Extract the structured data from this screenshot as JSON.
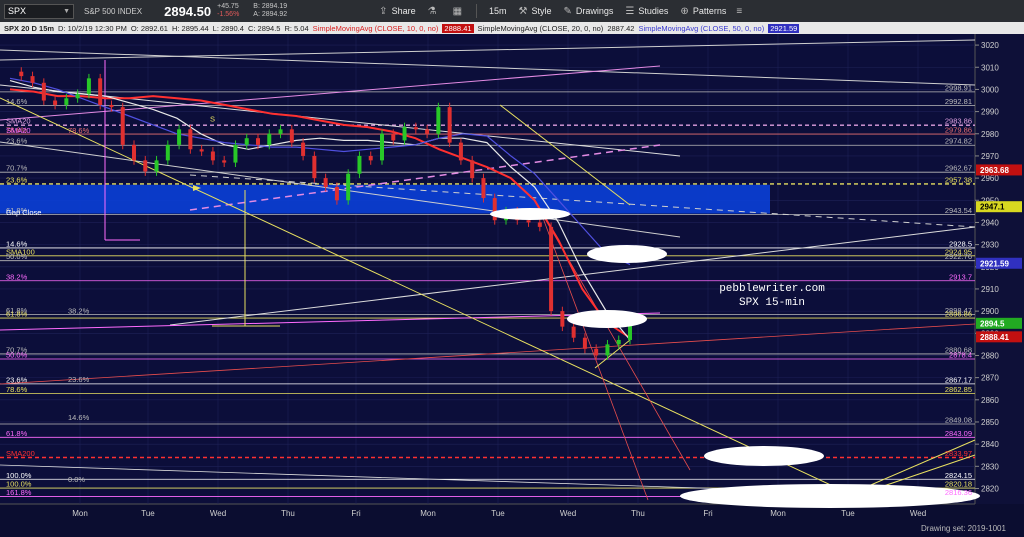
{
  "toolbar": {
    "symbol": "SPX",
    "name": "S&P 500 INDEX",
    "last": "2894.50",
    "change": "+45.75",
    "change_pct": "-1.56%",
    "bid": "B: 2894.19",
    "ask": "A: 2894.92",
    "share_label": "Share",
    "interval": "15m",
    "style_label": "Style",
    "drawings_label": "Drawings",
    "studies_label": "Studies",
    "patterns_label": "Patterns"
  },
  "infobar": {
    "desc": "SPX 20 D 15m",
    "date": "D: 10/2/19 12:30 PM",
    "open": "O: 2892.61",
    "high": "H: 2895.44",
    "low": "L: 2890.4",
    "close": "C: 2894.5",
    "range": "R: 5.04",
    "sma10": "SimpleMovingAvg (CLOSE, 10, 0, no)",
    "sma10_val": "2888.41",
    "sma20": "SimpleMovingAvg (CLOSE, 20, 0, no)",
    "sma20_val": "2887.42",
    "sma50": "SimpleMovingAvg (CLOSE, 50, 0, no)",
    "sma50_val": "2921.59"
  },
  "annotation": {
    "line1": "pebblewriter.com",
    "line2": "SPX 15-min"
  },
  "footer": {
    "drawing_set": "Drawing set: 2019-1001"
  },
  "colors": {
    "background": "#0c0e3a",
    "price_tag_red": "#c21010",
    "price_tag_blue": "#3030c0",
    "fib_yellow": "#e8e060",
    "fib_magenta": "#ff6cff"
  },
  "chart_data": {
    "type": "line",
    "title": "SPX 15-min",
    "y_range": [
      2813,
      3025
    ],
    "y_ticks": [
      3020,
      3010,
      3000,
      2990,
      2980,
      2970,
      2960,
      2950,
      2940,
      2930,
      2920,
      2910,
      2900,
      2890,
      2880,
      2870,
      2860,
      2850,
      2840,
      2830,
      2820
    ],
    "x_labels": [
      "Mon",
      "Tue",
      "Wed",
      "Thu",
      "Fri",
      "Mon",
      "Tue",
      "Wed",
      "Thu",
      "Fri",
      "Mon",
      "Tue",
      "Wed"
    ],
    "price_tags": [
      {
        "label": "2963.68",
        "value": 2963.68,
        "color": "#c21010"
      },
      {
        "label": "2947.1",
        "value": 2947.1,
        "color": "#d8d820"
      },
      {
        "label": "2921.59",
        "value": 2921.59,
        "color": "#3030c0"
      },
      {
        "label": "2894.5",
        "value": 2894.5,
        "color": "#22aa22"
      },
      {
        "label": "2888.41",
        "value": 2888.41,
        "color": "#c21010"
      }
    ],
    "horizontal_levels": [
      {
        "value": 2998.91,
        "right": "2998.91",
        "left": "",
        "color": "#bbbbbb"
      },
      {
        "value": 2992.81,
        "right": "2992.81",
        "left": "14.6%",
        "color": "#bbbbbb"
      },
      {
        "value": 2983.86,
        "right": "2983.86",
        "left": "SMA20",
        "color": "#e0a0e0",
        "dashed": true
      },
      {
        "value": 2979.86,
        "right": "2979.86",
        "left": "78.6%",
        "color": "#e86e6e"
      },
      {
        "value": 2974.82,
        "right": "2974.82",
        "left": "23.6%",
        "color": "#bbbbbb"
      },
      {
        "value": 2962.67,
        "right": "2962.67",
        "left": "70.7%",
        "color": "#bbbbbb"
      },
      {
        "value": 2957.38,
        "right": "2957.38",
        "left": "23.6%",
        "color": "#e8e060",
        "dashed": true
      },
      {
        "value": 2943.54,
        "right": "2943.54",
        "left": "61.8%",
        "color": "#bbbbbb"
      },
      {
        "value": 2928.5,
        "right": "2928.5",
        "left": "14.6%",
        "color": "#ffffff"
      },
      {
        "value": 2924.95,
        "right": "2924.95",
        "left": "SMA100",
        "color": "#e8e060"
      },
      {
        "value": 2922.76,
        "right": "2922.76",
        "left": "50.0%",
        "color": "#bbbbbb"
      },
      {
        "value": 2913.7,
        "right": "2913.7",
        "left": "38.2%",
        "color": "#ff6cff"
      },
      {
        "value": 2898.47,
        "right": "2898.47",
        "left": "61.8%",
        "color": "#bbbbbb"
      },
      {
        "value": 2896.86,
        "right": "2896.86",
        "left": "61.8%",
        "color": "#e8e060"
      },
      {
        "value": 2880.68,
        "right": "2880.68",
        "left": "70.7%",
        "color": "#bbbbbb"
      },
      {
        "value": 2878.4,
        "right": "2878.4",
        "left": "50.0%",
        "color": "#ff6cff"
      },
      {
        "value": 2867.17,
        "right": "2867.17",
        "left": "23.6%",
        "color": "#ffffff"
      },
      {
        "value": 2862.85,
        "right": "2862.85",
        "left": "78.6%",
        "color": "#e8e060"
      },
      {
        "value": 2849.08,
        "right": "2849.08",
        "left": "",
        "color": "#bbbbbb"
      },
      {
        "value": 2843.09,
        "right": "2843.09",
        "left": "61.8%",
        "color": "#ff6cff"
      },
      {
        "value": 2833.97,
        "right": "2833.97",
        "left": "SMA200",
        "color": "#ff3030",
        "dashed": true
      },
      {
        "value": 2824.15,
        "right": "2824.15",
        "left": "100.0%",
        "color": "#ffffff"
      },
      {
        "value": 2820.18,
        "right": "2820.18",
        "left": "100.0%",
        "color": "#e8e060"
      },
      {
        "value": 2816.36,
        "right": "2816.36",
        "left": "161.8%",
        "color": "#ff6cff"
      }
    ],
    "inner_labels": [
      {
        "text": "SMA20",
        "value": 2979.86
      },
      {
        "text": "78.6%",
        "value": 2979.86
      },
      {
        "text": "S",
        "value": 2985
      },
      {
        "text": "Gap Close",
        "value": 2943
      },
      {
        "text": "38.2%",
        "value": 2898.5
      },
      {
        "text": "23.6%",
        "value": 2867.5
      },
      {
        "text": "14.6%",
        "value": 2850.5
      },
      {
        "text": "0.0%",
        "value": 2822.5
      }
    ],
    "gap_zone": [
      2944,
      2957
    ],
    "price_series": {
      "name": "SPX",
      "values": [
        3008,
        3006,
        3003,
        2995,
        2993,
        2996,
        2998,
        3005,
        2993,
        2992,
        2975,
        2968,
        2963,
        2968,
        2975,
        2982,
        2973,
        2972,
        2968,
        2967,
        2975,
        2978,
        2975,
        2980,
        2982,
        2976,
        2970,
        2960,
        2956,
        2950,
        2962,
        2970,
        2968,
        2980,
        2977,
        2983,
        2982,
        2980,
        2992,
        2976,
        2968,
        2960,
        2951,
        2941,
        2945,
        2941,
        2940,
        2938,
        2900,
        2893,
        2888,
        2883,
        2880,
        2885,
        2887,
        2894
      ]
    },
    "sma_series": [
      {
        "name": "SMA10",
        "color": "#ff3030",
        "values": [
          3000,
          2999,
          2997,
          2997,
          2996,
          2996,
          2997,
          2996,
          2995,
          2993,
          2991,
          2989,
          2988,
          2986,
          2984,
          2983,
          2981,
          2978,
          2973,
          2969,
          2965,
          2960,
          2950,
          2932,
          2910,
          2895,
          2888
        ]
      },
      {
        "name": "SMA20",
        "color": "#e8e8e8",
        "values": [
          3004,
          3001,
          2999,
          2998,
          2997,
          2994,
          2991,
          2987,
          2980,
          2975,
          2973,
          2975,
          2977,
          2978,
          2977,
          2977,
          2976,
          2975,
          2978,
          2978,
          2976,
          2965,
          2956,
          2940,
          2918,
          2900,
          2887
        ]
      },
      {
        "name": "SMA50",
        "color": "#5050e0",
        "values": [
          3005,
          3003,
          3000,
          2996,
          2992,
          2988,
          2984,
          2980,
          2978,
          2976,
          2975,
          2974,
          2974,
          2973,
          2972,
          2973,
          2974,
          2975,
          2978,
          2980,
          2979,
          2970,
          2962,
          2950,
          2938,
          2926,
          2921
        ]
      }
    ]
  }
}
